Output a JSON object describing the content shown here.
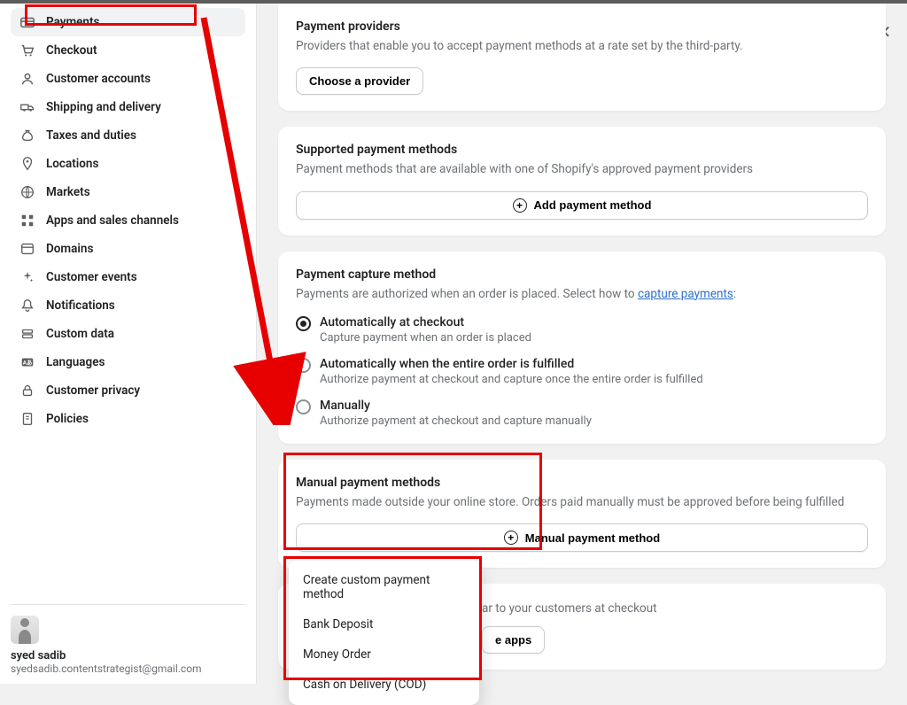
{
  "sidebar": {
    "items": [
      {
        "label": "Payments",
        "icon": "credit-card"
      },
      {
        "label": "Checkout",
        "icon": "cart"
      },
      {
        "label": "Customer accounts",
        "icon": "person"
      },
      {
        "label": "Shipping and delivery",
        "icon": "truck"
      },
      {
        "label": "Taxes and duties",
        "icon": "money-bag"
      },
      {
        "label": "Locations",
        "icon": "pin"
      },
      {
        "label": "Markets",
        "icon": "globe"
      },
      {
        "label": "Apps and sales channels",
        "icon": "grid"
      },
      {
        "label": "Domains",
        "icon": "browser"
      },
      {
        "label": "Customer events",
        "icon": "sparkle"
      },
      {
        "label": "Notifications",
        "icon": "bell"
      },
      {
        "label": "Custom data",
        "icon": "layers"
      },
      {
        "label": "Languages",
        "icon": "translate"
      },
      {
        "label": "Customer privacy",
        "icon": "lock"
      },
      {
        "label": "Policies",
        "icon": "policy"
      }
    ],
    "user": {
      "name": "syed sadib",
      "email": "syedsadib.contentstrategist@gmail.com"
    }
  },
  "cards": {
    "providers": {
      "title": "Payment providers",
      "desc": "Providers that enable you to accept payment methods at a rate set by the third-party.",
      "button": "Choose a provider"
    },
    "supported": {
      "title": "Supported payment methods",
      "desc": "Payment methods that are available with one of Shopify's approved payment providers",
      "button": "Add payment method"
    },
    "capture": {
      "title": "Payment capture method",
      "desc_pre": "Payments are authorized when an order is placed. Select how to ",
      "link": "capture payments",
      "desc_post": ":",
      "options": [
        {
          "label": "Automatically at checkout",
          "sub": "Capture payment when an order is placed",
          "selected": true
        },
        {
          "label": "Automatically when the entire order is fulfilled",
          "sub": "Authorize payment at checkout and capture once the entire order is fulfilled",
          "selected": false
        },
        {
          "label": "Manually",
          "sub": "Authorize payment at checkout and capture manually",
          "selected": false
        }
      ]
    },
    "manual": {
      "title": "Manual payment methods",
      "desc": "Payments made outside your online store. Orders paid manually must be approved before being fulfilled",
      "button": "Manual payment method"
    },
    "customize": {
      "desc_suffix": "ar to your customers at checkout",
      "button_suffix": "e apps"
    }
  },
  "dropdown": {
    "items": [
      "Create custom payment method",
      "Bank Deposit",
      "Money Order",
      "Cash on Delivery (COD)"
    ]
  }
}
